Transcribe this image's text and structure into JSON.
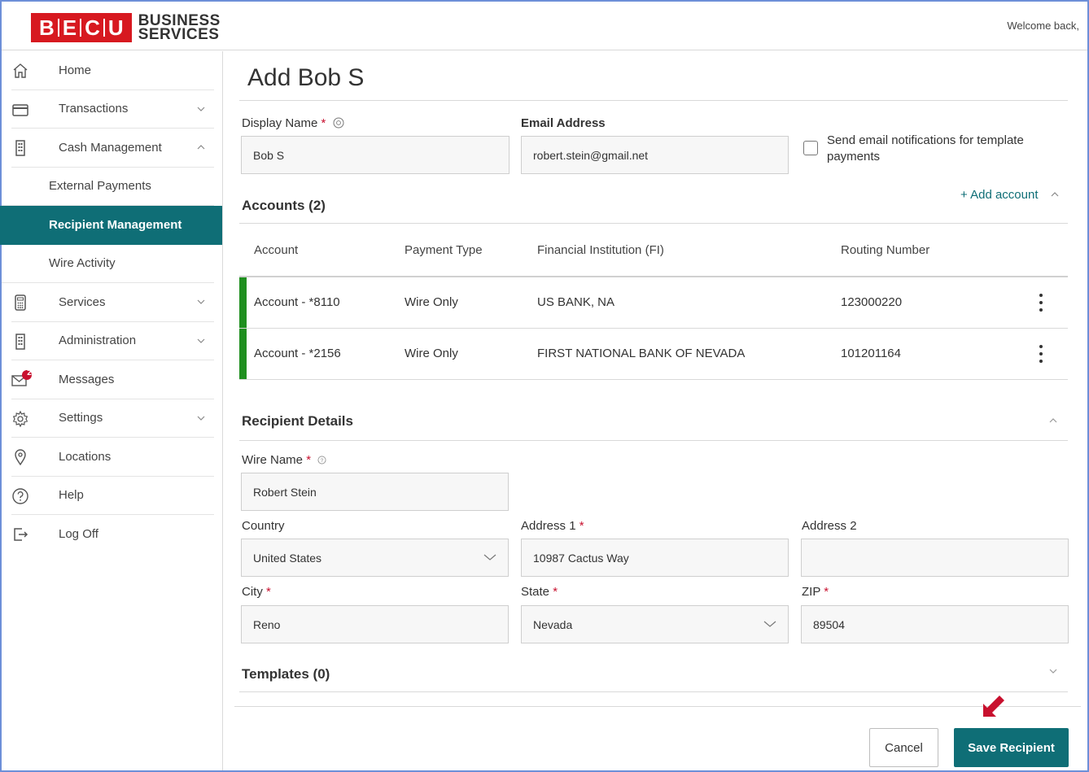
{
  "header": {
    "logo_letters": [
      "B",
      "E",
      "C",
      "U"
    ],
    "logo_text_line1": "BUSINESS",
    "logo_text_line2": "SERVICES",
    "welcome": "Welcome back,",
    "brand_color": "#d71920"
  },
  "sidebar": {
    "items": [
      {
        "label": "Home",
        "icon": "home-icon",
        "chevron": null
      },
      {
        "label": "Transactions",
        "icon": "card-icon",
        "chevron": "down"
      },
      {
        "label": "Cash Management",
        "icon": "building-icon",
        "chevron": "up"
      },
      {
        "label": "Services",
        "icon": "calculator-icon",
        "chevron": "down"
      },
      {
        "label": "Administration",
        "icon": "building-icon",
        "chevron": "down"
      },
      {
        "label": "Messages",
        "icon": "envelope-icon",
        "chevron": null,
        "badge": "2"
      },
      {
        "label": "Settings",
        "icon": "gear-icon",
        "chevron": "down"
      },
      {
        "label": "Locations",
        "icon": "location-pin-icon",
        "chevron": null
      },
      {
        "label": "Help",
        "icon": "help-icon",
        "chevron": null
      },
      {
        "label": "Log Off",
        "icon": "logout-icon",
        "chevron": null
      }
    ],
    "sub_items": [
      {
        "label": "External Payments",
        "active": false
      },
      {
        "label": "Recipient Management",
        "active": true
      },
      {
        "label": "Wire Activity",
        "active": false
      }
    ],
    "active_color": "#0f6e76"
  },
  "main": {
    "title": "Add Bob S",
    "display_name": {
      "label": "Display Name",
      "required": "*",
      "value": "Bob S"
    },
    "email": {
      "label": "Email Address",
      "value": "robert.stein@gmail.net"
    },
    "notify": {
      "label_line1": "Send email notifications for template",
      "label_line2": "payments",
      "checked": false
    },
    "accounts": {
      "title": "Accounts (2)",
      "add_label": "+ Add account",
      "columns": [
        "Account",
        "Payment Type",
        "Financial Institution (FI)",
        "Routing Number"
      ],
      "rows": [
        {
          "account": "Account - *8110",
          "payment_type": "Wire Only",
          "fi": "US BANK, NA",
          "routing": "123000220"
        },
        {
          "account": "Account - *2156",
          "payment_type": "Wire Only",
          "fi": "FIRST NATIONAL BANK OF NEVADA",
          "routing": "101201164"
        }
      ],
      "row_accent": "#1f8f1f"
    },
    "recipient": {
      "title": "Recipient Details",
      "wire_name": {
        "label": "Wire Name",
        "required": "*",
        "value": "Robert Stein"
      },
      "country": {
        "label": "Country",
        "value": "United States"
      },
      "address1": {
        "label": "Address 1",
        "required": "*",
        "value": "10987 Cactus Way"
      },
      "address2": {
        "label": "Address 2",
        "value": ""
      },
      "city": {
        "label": "City",
        "required": "*",
        "value": "Reno"
      },
      "state": {
        "label": "State",
        "required": "*",
        "value": "Nevada"
      },
      "zip": {
        "label": "ZIP",
        "required": "*",
        "value": "89504"
      }
    },
    "templates": {
      "title": "Templates (0)"
    },
    "buttons": {
      "cancel": "Cancel",
      "save": "Save Recipient"
    },
    "annotation_arrow_color": "#c8102e"
  }
}
